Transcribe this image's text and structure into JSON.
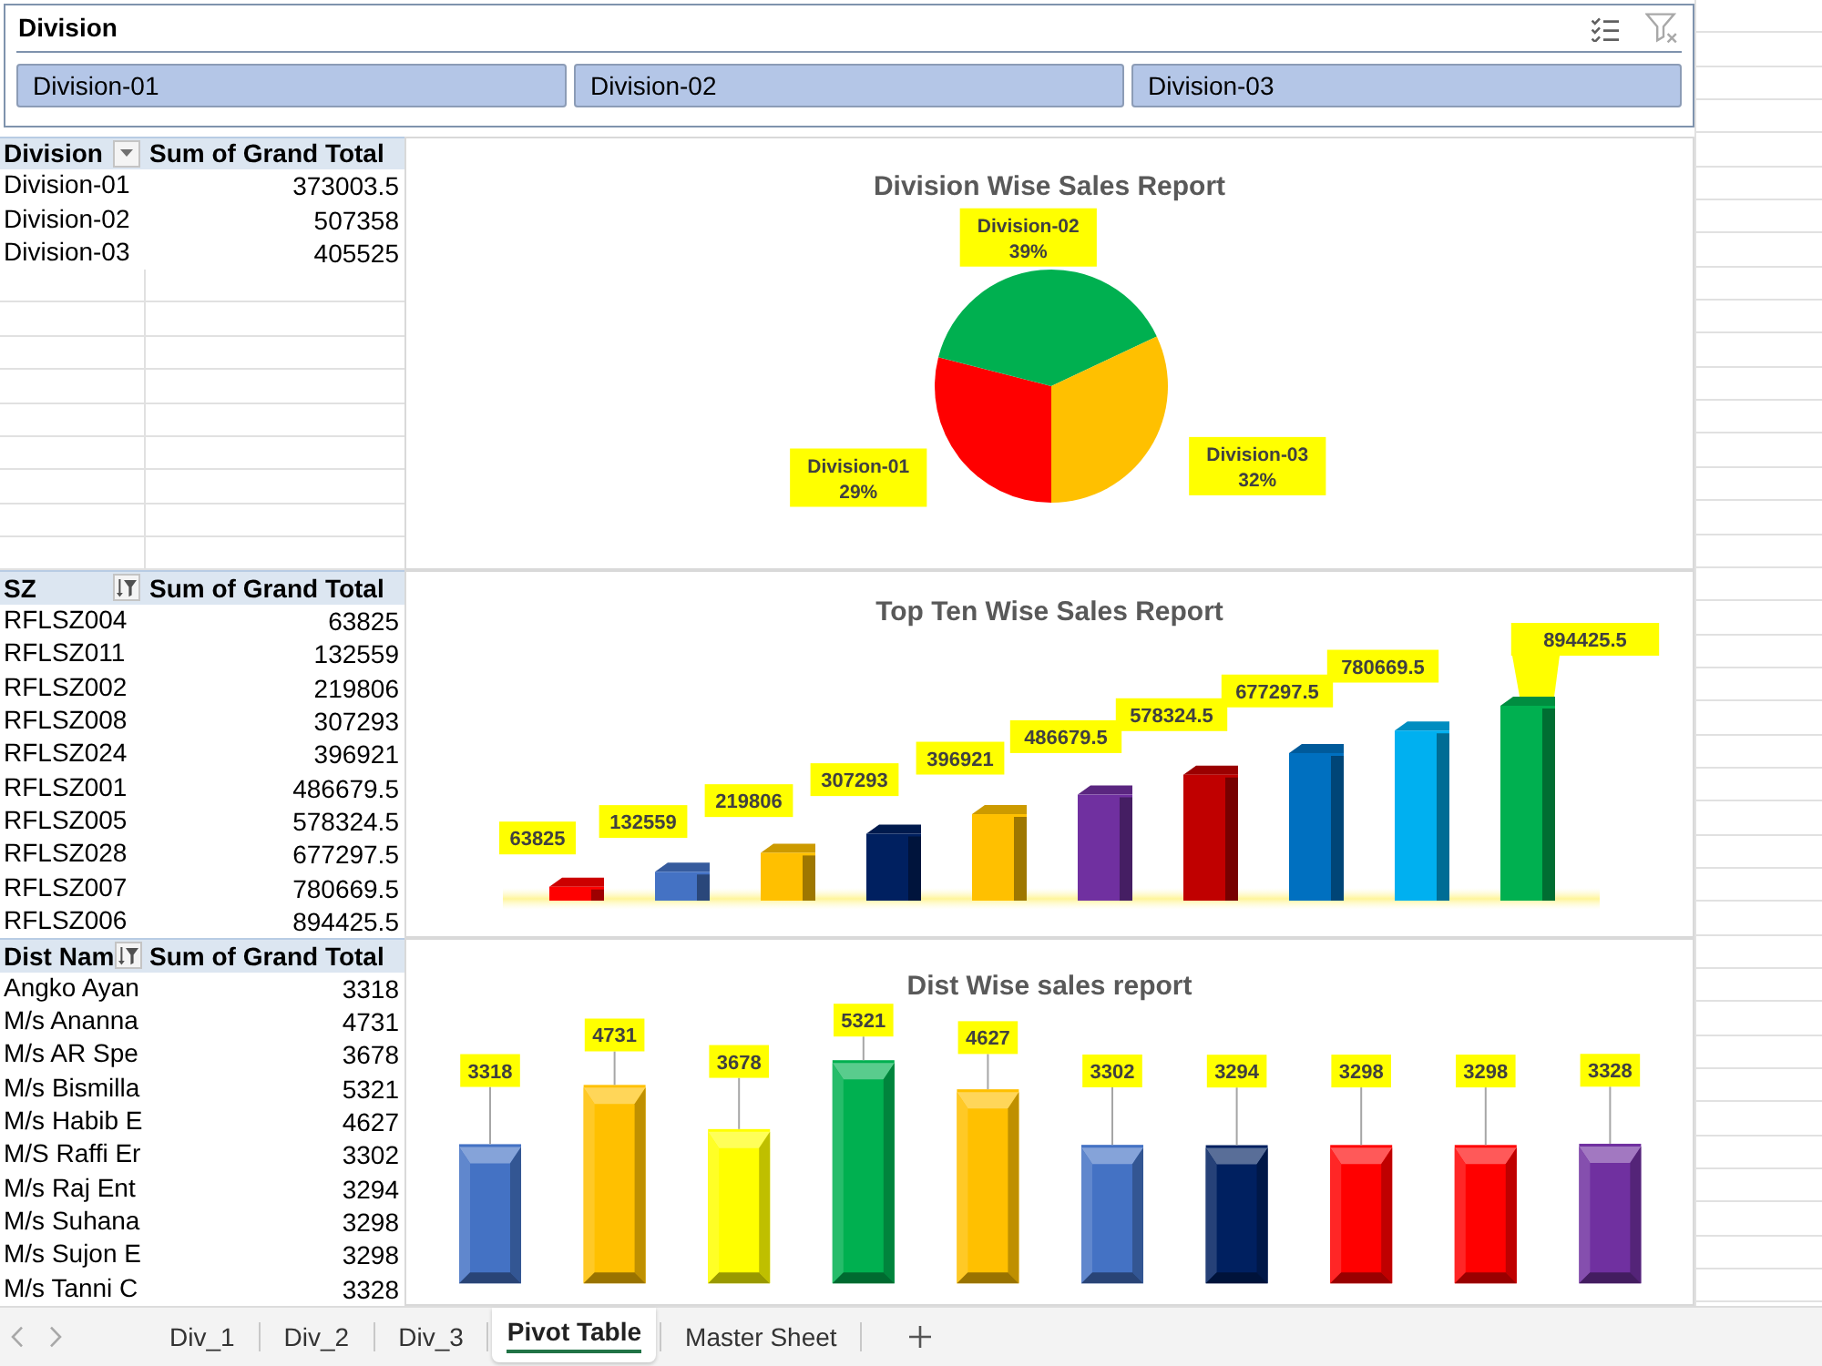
{
  "slicer": {
    "title": "Division",
    "items": [
      {
        "label": "Division-01",
        "selected": true
      },
      {
        "label": "Division-02",
        "selected": true
      },
      {
        "label": "Division-03",
        "selected": true
      }
    ]
  },
  "sections": [
    {
      "pivot_table": {
        "columns": [
          "Division",
          "Sum of Grand Total"
        ],
        "filtered": false,
        "rows": [
          [
            "Division-01",
            "373003.5"
          ],
          [
            "Division-02",
            "507358"
          ],
          [
            "Division-03",
            "405525"
          ]
        ]
      },
      "chart_data": {
        "type": "pie",
        "title": "Division Wise Sales Report",
        "categories": [
          "Division-01",
          "Division-02",
          "Division-03"
        ],
        "values": [
          29,
          39,
          32
        ],
        "value_labels": [
          "29%",
          "39%",
          "32%"
        ],
        "colors": [
          "#ff0000",
          "#00b050",
          "#ffc000"
        ]
      }
    },
    {
      "pivot_table": {
        "columns": [
          "SZ",
          "Sum of Grand Total"
        ],
        "filtered": true,
        "rows": [
          [
            "RFLSZ004",
            "63825"
          ],
          [
            "RFLSZ011",
            "132559"
          ],
          [
            "RFLSZ002",
            "219806"
          ],
          [
            "RFLSZ008",
            "307293"
          ],
          [
            "RFLSZ024",
            "396921"
          ],
          [
            "RFLSZ001",
            "486679.5"
          ],
          [
            "RFLSZ005",
            "578324.5"
          ],
          [
            "RFLSZ028",
            "677297.5"
          ],
          [
            "RFLSZ007",
            "780669.5"
          ],
          [
            "RFLSZ006",
            "894425.5"
          ]
        ]
      },
      "chart_data": {
        "type": "bar",
        "title": "Top Ten Wise Sales Report",
        "categories": [
          null,
          null,
          null,
          null,
          null,
          null,
          null,
          null,
          null,
          null
        ],
        "values": [
          63825,
          132559,
          219806,
          307293,
          396921,
          486679.5,
          578324.5,
          677297.5,
          780669.5,
          894425.5
        ],
        "value_labels": [
          "63825",
          "132559",
          "219806",
          "307293",
          "396921",
          "486679.5",
          "578324.5",
          "677297.5",
          "780669.5",
          "894425.5"
        ],
        "colors": [
          "#ff0000",
          "#4472c4",
          "#ffc000",
          "#002060",
          "#ffc000",
          "#7030a0",
          "#c00000",
          "#0070c0",
          "#00b0f0",
          "#00b050"
        ]
      }
    },
    {
      "pivot_table": {
        "columns": [
          "Dist Nam",
          "Sum of Grand Total"
        ],
        "filtered": true,
        "rows": [
          [
            "Angko Ayan",
            "3318"
          ],
          [
            "M/s Ananna",
            "4731"
          ],
          [
            "M/s AR Spe",
            "3678"
          ],
          [
            "M/s Bismilla",
            "5321"
          ],
          [
            "M/s Habib E",
            "4627"
          ],
          [
            "M/S Raffi Er",
            "3302"
          ],
          [
            "M/s Raj Ent",
            "3294"
          ],
          [
            "M/s Suhana",
            "3298"
          ],
          [
            "M/s Sujon E",
            "3298"
          ],
          [
            "M/s Tanni C",
            "3328"
          ]
        ]
      },
      "chart_data": {
        "type": "bar",
        "title": "Dist Wise sales report",
        "categories": [
          null,
          null,
          null,
          null,
          null,
          null,
          null,
          null,
          null,
          null
        ],
        "values": [
          3318,
          4731,
          3678,
          5321,
          4627,
          3302,
          3294,
          3298,
          3298,
          3328
        ],
        "value_labels": [
          "3318",
          "4731",
          "3678",
          "5321",
          "4627",
          "3302",
          "3294",
          "3298",
          "3298",
          "3328"
        ],
        "colors": [
          "#4472c4",
          "#ffc000",
          "#ffff00",
          "#00b050",
          "#ffc000",
          "#4472c4",
          "#002060",
          "#ff0000",
          "#ff0000",
          "#7030a0"
        ]
      }
    }
  ],
  "sheet_tabs": [
    {
      "label": "Div_1",
      "selected": false
    },
    {
      "label": "Div_2",
      "selected": false
    },
    {
      "label": "Div_3",
      "selected": false
    },
    {
      "label": "Pivot Table",
      "selected": true
    },
    {
      "label": "Master Sheet",
      "selected": false
    }
  ]
}
